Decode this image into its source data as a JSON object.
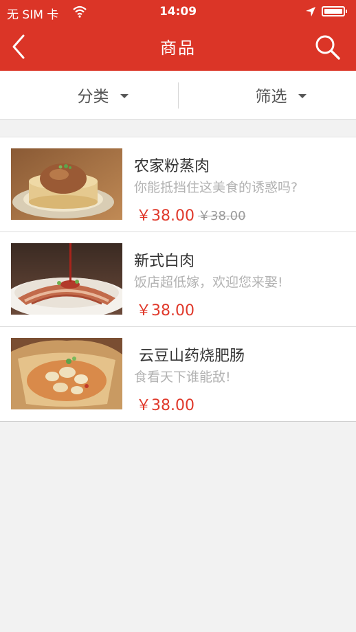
{
  "status_bar": {
    "carrier": "无 SIM 卡",
    "time": "14:09"
  },
  "nav": {
    "title": "商品",
    "back_icon": "chevron-left-icon",
    "search_icon": "search-icon"
  },
  "filters": [
    {
      "label": "分类"
    },
    {
      "label": "筛选"
    }
  ],
  "items": [
    {
      "name": "农家粉蒸肉",
      "desc": "你能抵挡住这美食的诱惑吗?",
      "price": "￥38.00",
      "old_price": "￥38.00"
    },
    {
      "name": "新式白肉",
      "desc": "饭店超低嫁，欢迎您来娶!",
      "price": "￥38.00"
    },
    {
      "name": " 云豆山药烧肥肠",
      "desc": "食看天下谁能敌!",
      "price": "￥38.00"
    }
  ],
  "colors": {
    "brand": "#db3527",
    "price": "#e0392b"
  }
}
